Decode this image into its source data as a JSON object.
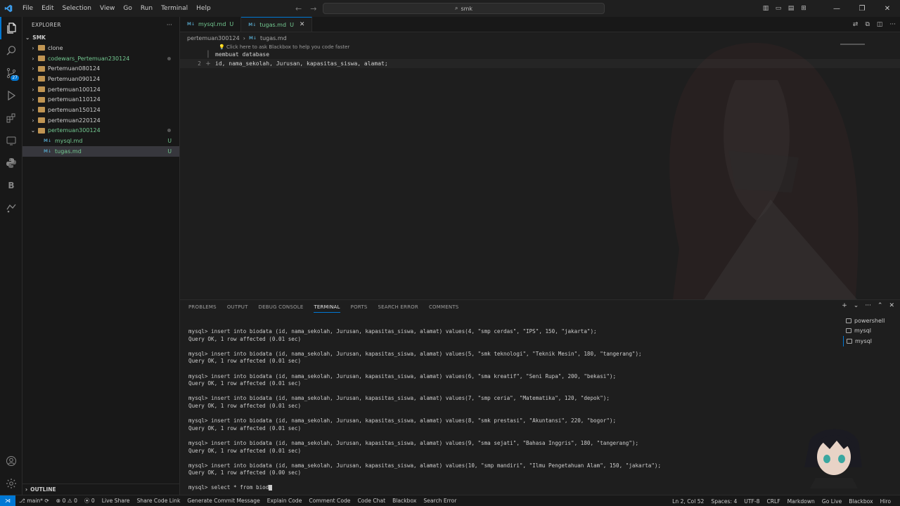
{
  "titlebar": {
    "menu": [
      "File",
      "Edit",
      "Selection",
      "View",
      "Go",
      "Run",
      "Terminal",
      "Help"
    ],
    "search": "smk"
  },
  "activity": {
    "source_control_badge": "27"
  },
  "sidebar": {
    "header": "EXPLORER",
    "root": "SMK",
    "items": [
      {
        "label": "clone",
        "type": "folder"
      },
      {
        "label": "codewars_Pertemuan230124",
        "type": "folder"
      },
      {
        "label": "Pertemuan080124",
        "type": "folder"
      },
      {
        "label": "Pertemuan090124",
        "type": "folder"
      },
      {
        "label": "pertemuan100124",
        "type": "folder"
      },
      {
        "label": "pertemuan110124",
        "type": "folder"
      },
      {
        "label": "pertemuan150124",
        "type": "folder"
      },
      {
        "label": "pertemuan220124",
        "type": "folder"
      },
      {
        "label": "pertemuan300124",
        "type": "folder-open"
      },
      {
        "label": "mysql.md",
        "type": "file",
        "status": "U"
      },
      {
        "label": "tugas.md",
        "type": "file",
        "status": "U"
      }
    ],
    "outline": "OUTLINE"
  },
  "editor": {
    "tabs": [
      {
        "label": "mysql.md",
        "status": "U"
      },
      {
        "label": "tugas.md",
        "status": "U"
      }
    ],
    "breadcrumb": [
      "pertemuan300124",
      "tugas.md"
    ],
    "hint": "Click here to ask Blackbox to help you code faster",
    "lines": [
      {
        "num": "",
        "text": "membuat database"
      },
      {
        "num": "2",
        "text": "id, nama_sekolah, Jurusan, kapasitas_siswa, alamat;"
      }
    ]
  },
  "panel": {
    "tabs": [
      "PROBLEMS",
      "OUTPUT",
      "DEBUG CONSOLE",
      "TERMINAL",
      "PORTS",
      "SEARCH ERROR",
      "COMMENTS"
    ],
    "active_tab": "TERMINAL",
    "terminals": [
      "powershell",
      "mysql",
      "mysql"
    ],
    "lines": [
      "mysql> insert into biodata (id, nama_sekolah, Jurusan, kapasitas_siswa, alamat) values(4, \"smp cerdas\", \"IPS\", 150, \"jakarta\");",
      "Query OK, 1 row affected (0.01 sec)",
      "",
      "mysql> insert into biodata (id, nama_sekolah, Jurusan, kapasitas_siswa, alamat) values(5, \"smk teknologi\", \"Teknik Mesin\", 180, \"tangerang\");",
      "Query OK, 1 row affected (0.01 sec)",
      "",
      "mysql> insert into biodata (id, nama_sekolah, Jurusan, kapasitas_siswa, alamat) values(6, \"sma kreatif\", \"Seni Rupa\", 200, \"bekasi\");",
      "Query OK, 1 row affected (0.01 sec)",
      "",
      "mysql> insert into biodata (id, nama_sekolah, Jurusan, kapasitas_siswa, alamat) values(7, \"smp ceria\", \"Matematika\", 120, \"depok\");",
      "Query OK, 1 row affected (0.01 sec)",
      "",
      "mysql> insert into biodata (id, nama_sekolah, Jurusan, kapasitas_siswa, alamat) values(8, \"smk prestasi\", \"Akuntansi\", 220, \"bogor\");",
      "Query OK, 1 row affected (0.01 sec)",
      "",
      "mysql> insert into biodata (id, nama_sekolah, Jurusan, kapasitas_siswa, alamat) values(9, \"sma sejati\", \"Bahasa Inggris\", 180, \"tangerang\");",
      "Query OK, 1 row affected (0.01 sec)",
      "",
      "mysql> insert into biodata (id, nama_sekolah, Jurusan, kapasitas_siswa, alamat) values(10, \"smp mandiri\", \"Ilmu Pengetahuan Alam\", 150, \"jakarta\");",
      "Query OK, 1 row affected (0.00 sec)",
      ""
    ],
    "prompt": "mysql> select * from biod"
  },
  "statusbar": {
    "branch": "main*",
    "errors": "0",
    "warnings": "0",
    "ports": "0",
    "left_items": [
      "Live Share",
      "Share Code Link",
      "Generate Commit Message",
      "Explain Code",
      "Comment Code",
      "Code Chat",
      "Blackbox",
      "Search Error"
    ],
    "right_items": [
      "Ln 2, Col 52",
      "Spaces: 4",
      "UTF-8",
      "CRLF",
      "Markdown",
      "Go Live",
      "Blackbox",
      "Hiro"
    ]
  },
  "colors": {
    "accent": "#0078d4",
    "untracked": "#73c991",
    "modified_tab": "#e2c08d"
  }
}
